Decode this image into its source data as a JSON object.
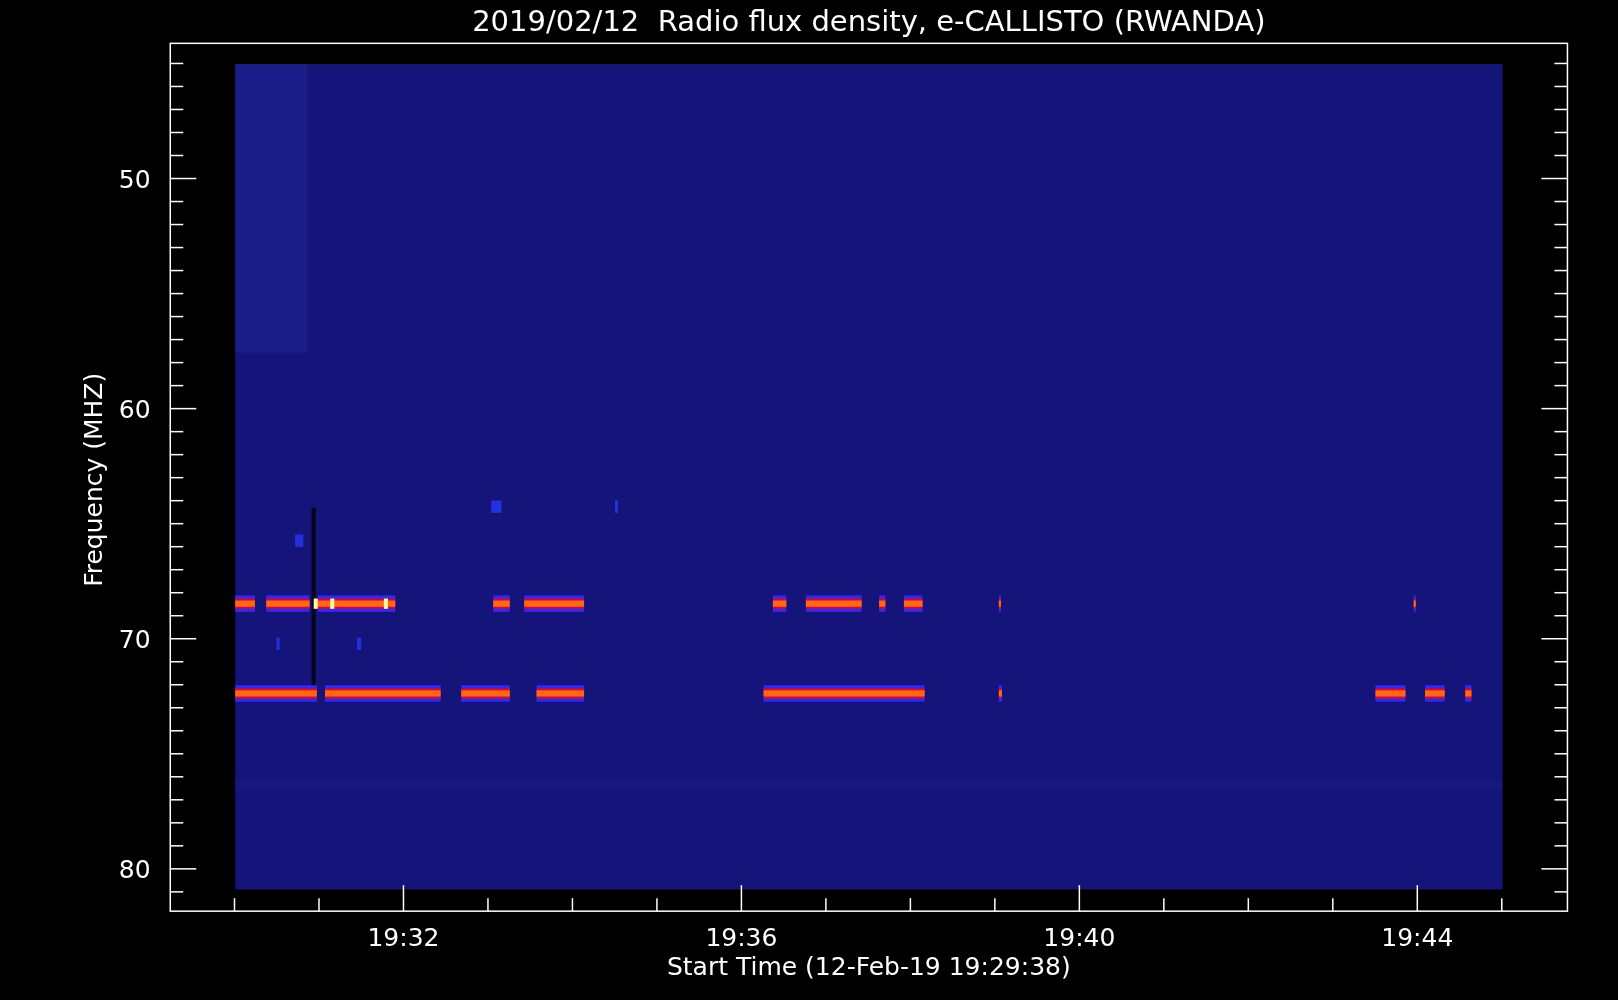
{
  "title": "2019/02/12  Radio flux density, e-CALLISTO (RWANDA)",
  "plot": {
    "ylabel": "Frequency (MHZ)",
    "xlabel": "Start Time (12-Feb-19 19:29:38)",
    "yticks": [
      "50",
      "60",
      "70",
      "80"
    ],
    "xticks": [
      "19:32",
      "19:36",
      "19:40",
      "19:44"
    ]
  }
}
